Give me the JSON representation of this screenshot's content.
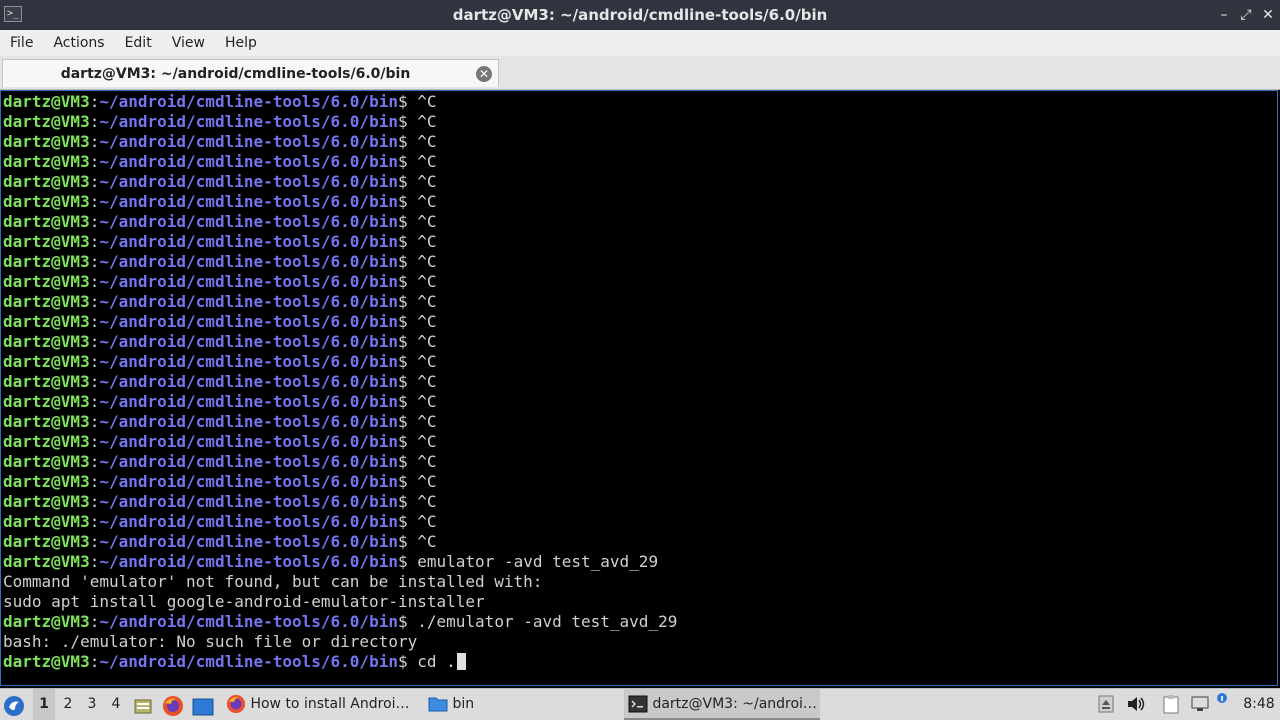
{
  "window": {
    "title": "dartz@VM3: ~/android/cmdline-tools/6.0/bin",
    "minimize_glyph": "–",
    "maximize_glyph": "⤢",
    "close_glyph": "✕"
  },
  "menu": [
    "File",
    "Actions",
    "Edit",
    "View",
    "Help"
  ],
  "tab": {
    "label": "dartz@VM3: ~/android/cmdline-tools/6.0/bin",
    "close_glyph": "✕"
  },
  "terminal": {
    "prompt_user": "dartz@VM3",
    "prompt_sep": ":",
    "prompt_path": "~/android/cmdline-tools/6.0/bin",
    "prompt_end": "$",
    "lines": [
      {
        "prompt": true,
        "cmd": "^C"
      },
      {
        "prompt": true,
        "cmd": "^C"
      },
      {
        "prompt": true,
        "cmd": "^C"
      },
      {
        "prompt": true,
        "cmd": "^C"
      },
      {
        "prompt": true,
        "cmd": "^C"
      },
      {
        "prompt": true,
        "cmd": "^C"
      },
      {
        "prompt": true,
        "cmd": "^C"
      },
      {
        "prompt": true,
        "cmd": "^C"
      },
      {
        "prompt": true,
        "cmd": "^C"
      },
      {
        "prompt": true,
        "cmd": "^C"
      },
      {
        "prompt": true,
        "cmd": "^C"
      },
      {
        "prompt": true,
        "cmd": "^C"
      },
      {
        "prompt": true,
        "cmd": "^C"
      },
      {
        "prompt": true,
        "cmd": "^C"
      },
      {
        "prompt": true,
        "cmd": "^C"
      },
      {
        "prompt": true,
        "cmd": "^C"
      },
      {
        "prompt": true,
        "cmd": "^C"
      },
      {
        "prompt": true,
        "cmd": "^C"
      },
      {
        "prompt": true,
        "cmd": "^C"
      },
      {
        "prompt": true,
        "cmd": "^C"
      },
      {
        "prompt": true,
        "cmd": "^C"
      },
      {
        "prompt": true,
        "cmd": "^C"
      },
      {
        "prompt": true,
        "cmd": "^C"
      },
      {
        "prompt": true,
        "cmd": "emulator -avd test_avd_29"
      },
      {
        "prompt": false,
        "text": "Command 'emulator' not found, but can be installed with:"
      },
      {
        "prompt": false,
        "text": "sudo apt install google-android-emulator-installer"
      },
      {
        "prompt": true,
        "cmd": "./emulator -avd test_avd_29"
      },
      {
        "prompt": false,
        "text": "bash: ./emulator: No such file or directory"
      },
      {
        "prompt": true,
        "cmd": "cd .",
        "cursor": true
      }
    ]
  },
  "taskbar": {
    "workspaces": [
      "1",
      "2",
      "3",
      "4"
    ],
    "active_workspace": "1",
    "tasks": [
      {
        "label": "How to install Androi…",
        "icon": "firefox-icon",
        "active": false
      },
      {
        "label": "bin",
        "icon": "folder-icon",
        "active": false
      },
      {
        "label": "dartz@VM3: ~/androi…",
        "icon": "terminal-icon",
        "active": true
      }
    ],
    "clock": "8:48"
  },
  "colors": {
    "prompt_user": "#7fe25c",
    "prompt_path": "#7575f0",
    "terminal_bg": "#000000",
    "titlebar_bg": "#2f343f"
  }
}
